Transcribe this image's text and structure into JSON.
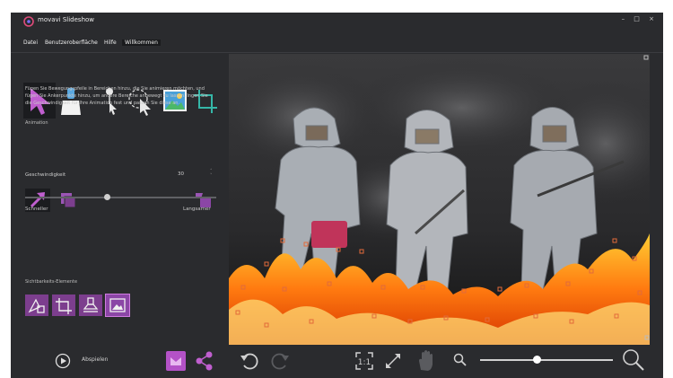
{
  "app": {
    "name": "movavi Slideshow",
    "window_controls": "– □ ×"
  },
  "menu": [
    {
      "label": "Datei"
    },
    {
      "label": "Benutzeroberfläche"
    },
    {
      "label": "Hilfe"
    },
    {
      "label": "Willkommen"
    }
  ],
  "tools": [
    {
      "name": "motion-arrow-tool",
      "label": "Bewegungspfeil"
    },
    {
      "name": "mask-brush-tool",
      "label": "Maske"
    },
    {
      "name": "pin-tool",
      "label": "Anker"
    },
    {
      "name": "lasso-tool",
      "label": "Lasso"
    },
    {
      "name": "sky-tool",
      "label": "Himmel"
    },
    {
      "name": "crop-tool",
      "label": "Zuschneiden"
    }
  ],
  "panel": {
    "section_title": "Animation",
    "description": "Fügen Sie Bewegungspfeile in Bereichen hinzu, die Sie animieren möchten, und fügen Sie Ankerpunkte hinzu, um andere Bereiche anbewegt zu lassen. Ingen Sie die Geschwindigkeit für Ihre Animation fest und passen Sie diese an.",
    "speed_label": "Geschwindigkeit",
    "speed_value": "30",
    "slider_left": "Schneller",
    "slider_right": "Langsamer",
    "slider_value": 0.43,
    "visibility_title": "Sichtbarkeits-Elemente"
  },
  "bottom": {
    "play_label": "Abspielen"
  },
  "zoom": {
    "value": 0.43
  },
  "colors": {
    "accent": "#8b46a6",
    "accent_light": "#c05fcf",
    "background": "#2a2b2e"
  }
}
